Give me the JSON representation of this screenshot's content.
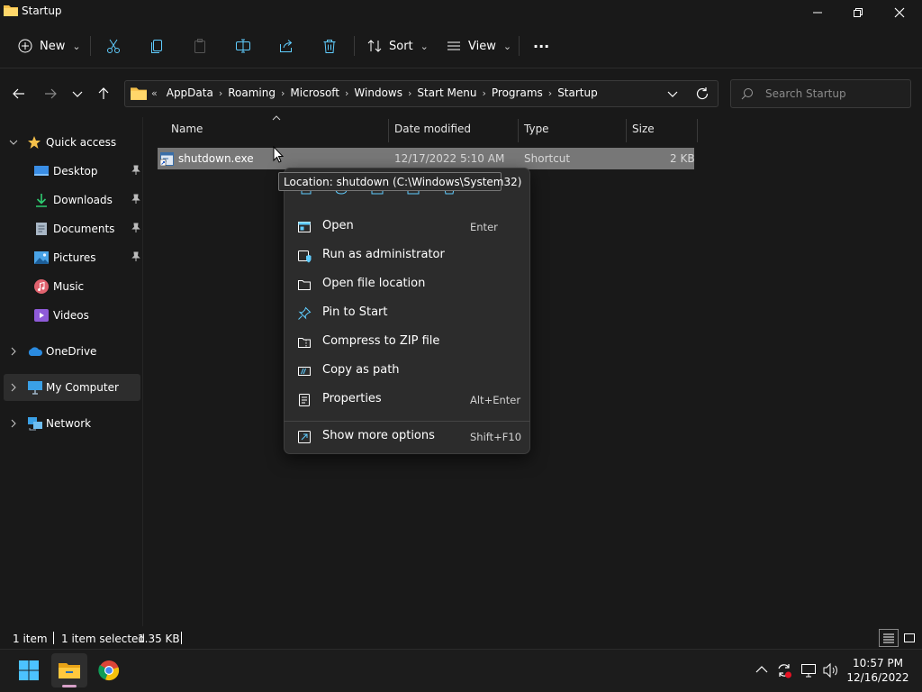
{
  "window": {
    "title": "Startup"
  },
  "toolbar": {
    "new_label": "New",
    "sort_label": "Sort",
    "view_label": "View",
    "more_label": "···"
  },
  "address": {
    "overflow": "«",
    "crumbs": [
      "AppData",
      "Roaming",
      "Microsoft",
      "Windows",
      "Start Menu",
      "Programs",
      "Startup"
    ]
  },
  "search": {
    "placeholder": "Search Startup"
  },
  "nav": {
    "quick_access": "Quick access",
    "desktop": "Desktop",
    "downloads": "Downloads",
    "documents": "Documents",
    "pictures": "Pictures",
    "music": "Music",
    "videos": "Videos",
    "onedrive": "OneDrive",
    "my_computer": "My Computer",
    "network": "Network"
  },
  "columns": {
    "name": "Name",
    "date": "Date modified",
    "type": "Type",
    "size": "Size"
  },
  "files": [
    {
      "name": "shutdown.exe",
      "date": "12/17/2022 5:10 AM",
      "type": "Shortcut",
      "size": "2 KB"
    }
  ],
  "tooltip": {
    "text": "Location: shutdown (C:\\Windows\\System32)"
  },
  "context_menu": {
    "open": {
      "label": "Open",
      "shortcut": "Enter"
    },
    "run_admin": {
      "label": "Run as administrator"
    },
    "open_location": {
      "label": "Open file location"
    },
    "pin_start": {
      "label": "Pin to Start"
    },
    "compress_zip": {
      "label": "Compress to ZIP file"
    },
    "copy_path": {
      "label": "Copy as path"
    },
    "properties": {
      "label": "Properties",
      "shortcut": "Alt+Enter"
    },
    "more_options": {
      "label": "Show more options",
      "shortcut": "Shift+F10"
    }
  },
  "status": {
    "count": "1 item",
    "selected": "1 item selected",
    "size": "1.35 KB"
  },
  "taskbar": {
    "time": "10:57 PM",
    "date": "12/16/2022"
  },
  "colors": {
    "accent": "#60cdff",
    "folder": "#f5c04a",
    "selection": "#777777"
  }
}
